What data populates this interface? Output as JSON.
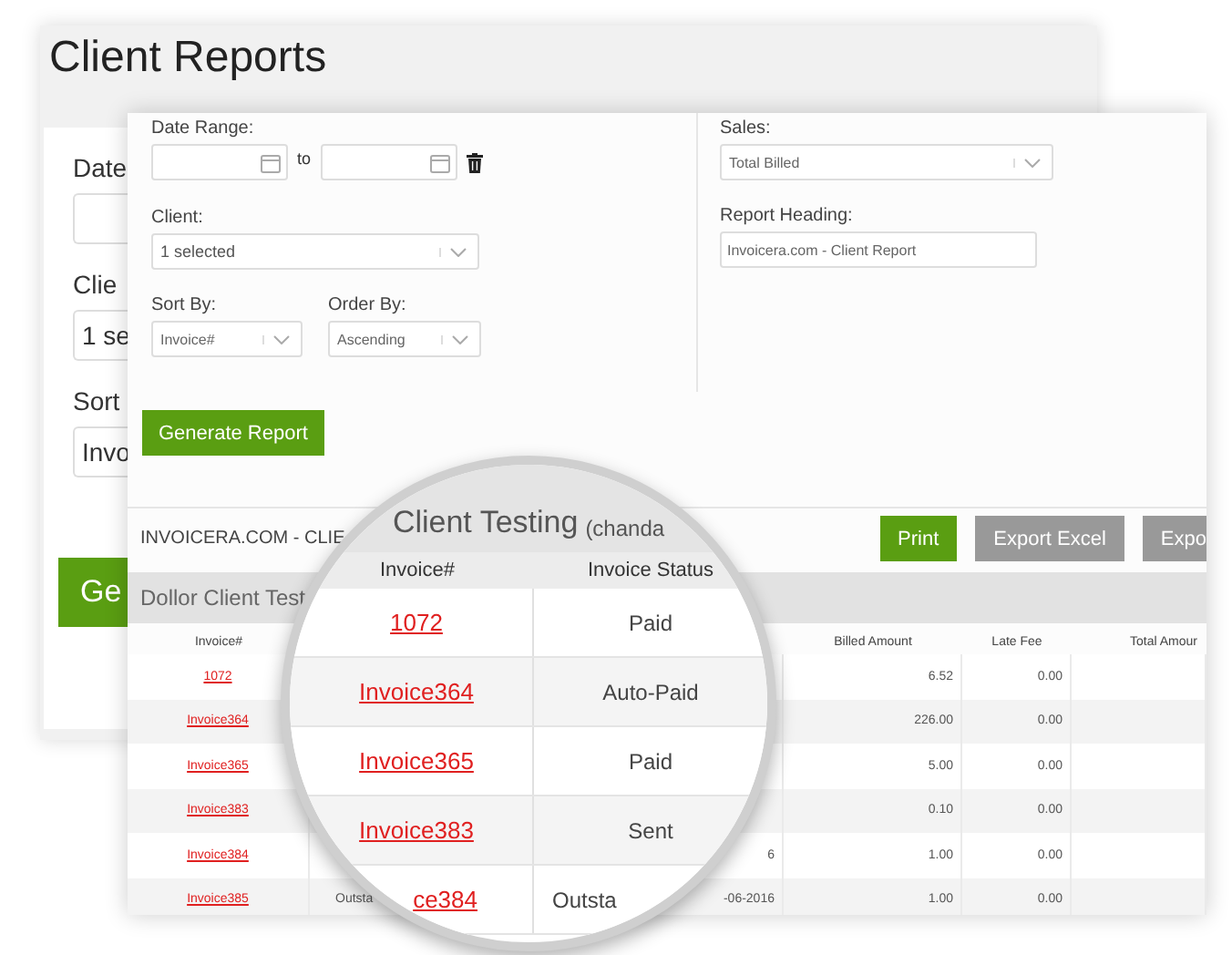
{
  "back_page": {
    "title": "Client Reports",
    "fields": [
      {
        "label": "Date"
      },
      {
        "label": "Clie",
        "value": "1 se"
      },
      {
        "label": "Sort",
        "value": "Invo"
      }
    ],
    "button": "Ge"
  },
  "form": {
    "date_range": {
      "label": "Date Range:",
      "to": "to"
    },
    "client": {
      "label": "Client:",
      "value": "1 selected"
    },
    "sort_by": {
      "label": "Sort By:",
      "value": "Invoice#"
    },
    "order_by": {
      "label": "Order By:",
      "value": "Ascending"
    },
    "sales": {
      "label": "Sales:",
      "value": "Total Billed"
    },
    "report_heading": {
      "label": "Report Heading:",
      "value": "Invoicera.com - Client Report"
    },
    "generate_button": "Generate Report"
  },
  "report": {
    "heading": "INVOICERA.COM - CLIE",
    "buttons": [
      {
        "label": "Print",
        "kind": "primary"
      },
      {
        "label": "Export Excel",
        "kind": "secondary"
      },
      {
        "label": "Expo",
        "kind": "secondary"
      }
    ],
    "group_title": "Dollor Client Test",
    "columns": {
      "invoice": "Invoice#",
      "billed": "Billed Amount",
      "late_fee": "Late Fee",
      "total": "Total Amour"
    },
    "rows": [
      {
        "invoice": "1072",
        "billed": "6.52",
        "late_fee": "0.00"
      },
      {
        "invoice": "Invoice364",
        "billed": "226.00",
        "late_fee": "0.00"
      },
      {
        "invoice": "Invoice365",
        "billed": "5.00",
        "late_fee": "0.00"
      },
      {
        "invoice": "Invoice383",
        "billed": "0.10",
        "late_fee": "0.00"
      },
      {
        "invoice": "Invoice384",
        "date": "6",
        "billed": "1.00",
        "late_fee": "0.00"
      },
      {
        "invoice": "Invoice385",
        "status": "Outsta",
        "date": "-06-2016",
        "billed": "1.00",
        "late_fee": "0.00"
      }
    ]
  },
  "magnifier": {
    "title": "Client Testing",
    "title_suffix": "(chanda",
    "columns": [
      "Invoice#",
      "Invoice Status"
    ],
    "rows": [
      {
        "invoice": "1072",
        "status": "Paid"
      },
      {
        "invoice": "Invoice364",
        "status": "Auto-Paid"
      },
      {
        "invoice": "Invoice365",
        "status": "Paid"
      },
      {
        "invoice": "Invoice383",
        "status": "Sent"
      },
      {
        "invoice": "ce384",
        "status": "Outsta"
      }
    ]
  }
}
